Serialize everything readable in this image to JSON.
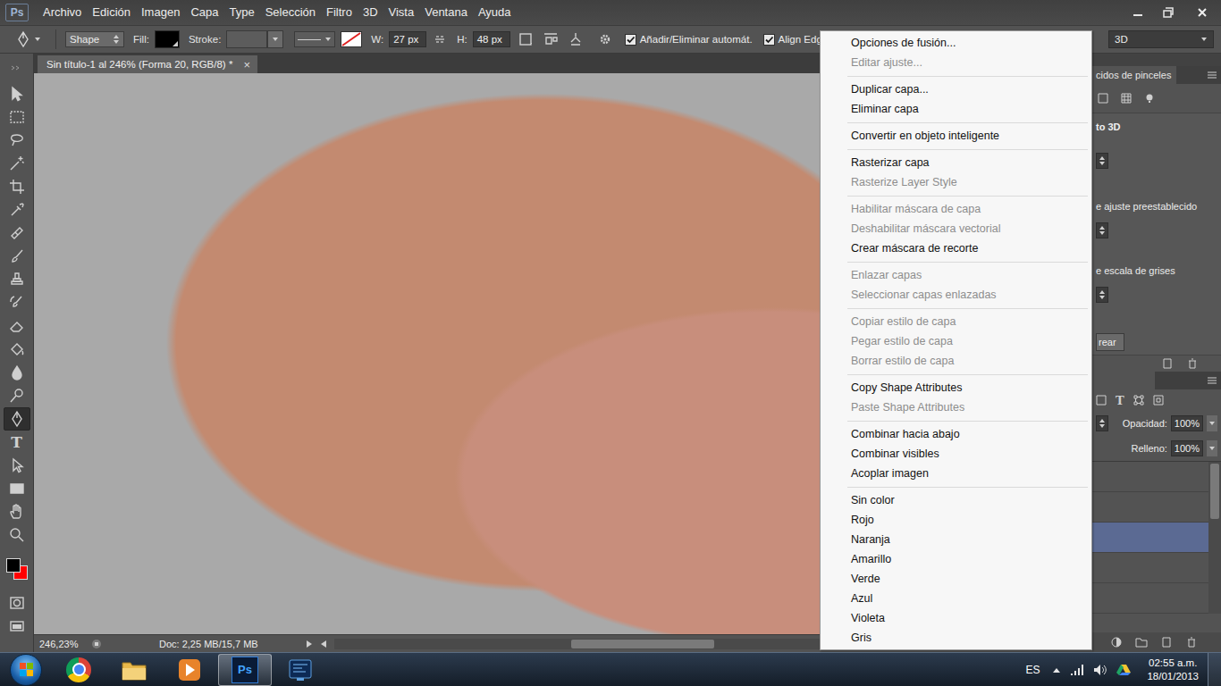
{
  "app": {
    "logo": "Ps"
  },
  "menu_bar": {
    "items": [
      "Archivo",
      "Edición",
      "Imagen",
      "Capa",
      "Type",
      "Selección",
      "Filtro",
      "3D",
      "Vista",
      "Ventana",
      "Ayuda"
    ]
  },
  "options_bar": {
    "mode": "Shape",
    "fill_label": "Fill:",
    "fill_color": "#000000",
    "stroke_label": "Stroke:",
    "w_label": "W:",
    "w_value": "27 px",
    "h_label": "H:",
    "h_value": "48 px",
    "checkboxes": [
      {
        "label": "Añadir/Eliminar automát.",
        "checked": true
      },
      {
        "label": "Align Edges",
        "checked": true
      }
    ],
    "workspace": "3D"
  },
  "document_tab": {
    "title": "Sin título-1 al 246% (Forma 20, RGB/8) *",
    "close": "×"
  },
  "tools": [
    {
      "kind": "move",
      "selected": false
    },
    {
      "kind": "marquee",
      "selected": false
    },
    {
      "kind": "lasso",
      "selected": false
    },
    {
      "kind": "wand",
      "selected": false
    },
    {
      "kind": "crop",
      "selected": false
    },
    {
      "kind": "eyedropper",
      "selected": false
    },
    {
      "kind": "heal",
      "selected": false
    },
    {
      "kind": "brush",
      "selected": false
    },
    {
      "kind": "stamp",
      "selected": false
    },
    {
      "kind": "history",
      "selected": false
    },
    {
      "kind": "eraser",
      "selected": false
    },
    {
      "kind": "bucket",
      "selected": false
    },
    {
      "kind": "blur",
      "selected": false
    },
    {
      "kind": "dodge",
      "selected": false
    },
    {
      "kind": "pen",
      "selected": true
    },
    {
      "kind": "type",
      "selected": false,
      "glyph": "T"
    },
    {
      "kind": "pathselect",
      "selected": false
    },
    {
      "kind": "rectangle",
      "selected": false
    },
    {
      "kind": "hand",
      "selected": false
    },
    {
      "kind": "zoom",
      "selected": false
    }
  ],
  "colors": {
    "foreground": "#000000",
    "background": "#ff0000"
  },
  "status_bar": {
    "zoom": "246,23%",
    "doc": "Doc: 2,25 MB/15,7 MB"
  },
  "right_panel": {
    "tab": "cidos de pinceles",
    "section_title": "to 3D",
    "labels": [
      "e ajuste preestablecido",
      "e escala de grises"
    ],
    "button": "rear",
    "layer_filter_glyph": "T",
    "opacity_label": "Opacidad:",
    "opacity": "100%",
    "fill_label": "Relleno:",
    "fill": "100%",
    "layers": [
      {
        "selected": false
      },
      {
        "selected": false
      },
      {
        "selected": true
      },
      {
        "selected": false
      },
      {
        "selected": false
      }
    ]
  },
  "context_menu": {
    "groups": [
      [
        {
          "label": "Opciones de fusión...",
          "disabled": false
        },
        {
          "label": "Editar ajuste...",
          "disabled": true
        }
      ],
      [
        {
          "label": "Duplicar capa...",
          "disabled": false
        },
        {
          "label": "Eliminar capa",
          "disabled": false
        }
      ],
      [
        {
          "label": "Convertir en objeto inteligente",
          "disabled": false
        }
      ],
      [
        {
          "label": "Rasterizar capa",
          "disabled": false
        },
        {
          "label": "Rasterize Layer Style",
          "disabled": true
        }
      ],
      [
        {
          "label": "Habilitar máscara de capa",
          "disabled": true
        },
        {
          "label": "Deshabilitar máscara vectorial",
          "disabled": true
        },
        {
          "label": "Crear máscara de recorte",
          "disabled": false
        }
      ],
      [
        {
          "label": "Enlazar capas",
          "disabled": true
        },
        {
          "label": "Seleccionar capas enlazadas",
          "disabled": true
        }
      ],
      [
        {
          "label": "Copiar estilo de capa",
          "disabled": true
        },
        {
          "label": "Pegar estilo de capa",
          "disabled": true
        },
        {
          "label": "Borrar estilo de capa",
          "disabled": true
        }
      ],
      [
        {
          "label": "Copy Shape Attributes",
          "disabled": false
        },
        {
          "label": "Paste Shape Attributes",
          "disabled": true
        }
      ],
      [
        {
          "label": "Combinar hacia abajo",
          "disabled": false
        },
        {
          "label": "Combinar visibles",
          "disabled": false
        },
        {
          "label": "Acoplar imagen",
          "disabled": false
        }
      ],
      [
        {
          "label": "Sin color",
          "disabled": false
        },
        {
          "label": "Rojo",
          "disabled": false
        },
        {
          "label": "Naranja",
          "disabled": false
        },
        {
          "label": "Amarillo",
          "disabled": false
        },
        {
          "label": "Verde",
          "disabled": false
        },
        {
          "label": "Azul",
          "disabled": false
        },
        {
          "label": "Violeta",
          "disabled": false
        },
        {
          "label": "Gris",
          "disabled": false
        }
      ]
    ]
  },
  "taskbar": {
    "apps": [
      {
        "kind": "chrome",
        "selected": false
      },
      {
        "kind": "explorer",
        "selected": false
      },
      {
        "kind": "media",
        "selected": false
      },
      {
        "kind": "photoshop",
        "selected": true,
        "glyph": "Ps"
      },
      {
        "kind": "app",
        "selected": false
      }
    ],
    "language": "ES",
    "time": "02:55 a.m.",
    "date": "18/01/2013"
  }
}
